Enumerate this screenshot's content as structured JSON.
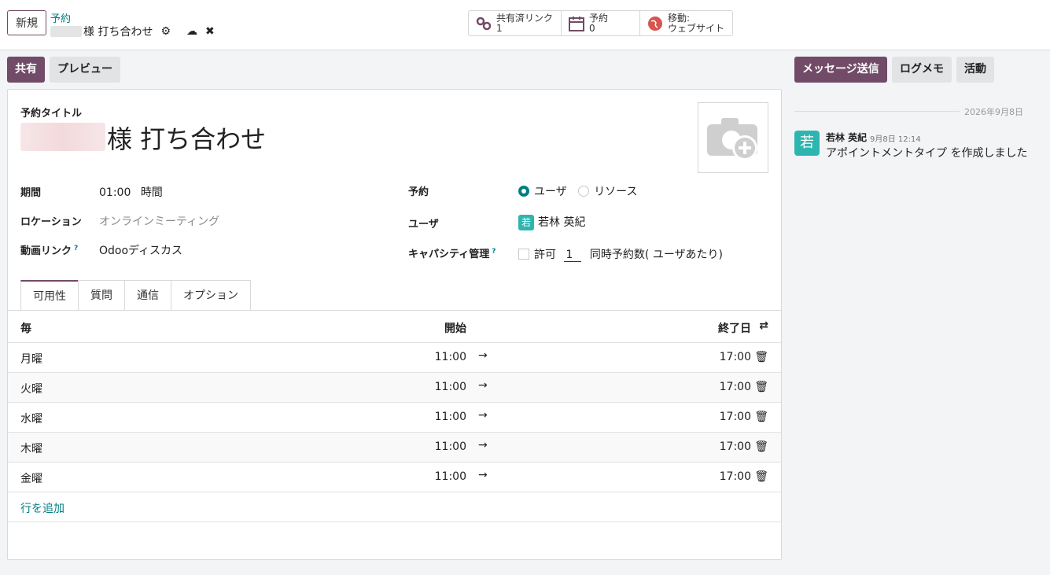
{
  "topbar": {
    "new_label": "新規",
    "breadcrumb_parent": "予約",
    "record_title": "様 打ち合わせ",
    "stats": [
      {
        "label": "共有済リンク",
        "value": "1",
        "icon": "link-icon"
      },
      {
        "label": "予約",
        "value": "0",
        "icon": "calendar-icon"
      },
      {
        "label": "移動:",
        "value": "ウェブサイト",
        "icon": "globe-icon"
      }
    ]
  },
  "controls": {
    "share_label": "共有",
    "preview_label": "プレビュー",
    "send_message_label": "メッセージ送信",
    "log_note_label": "ログメモ",
    "activity_label": "活動"
  },
  "form": {
    "title_label": "予約タイトル",
    "title_value": "様 打ち合わせ",
    "duration_label": "期間",
    "duration_value": "01:00",
    "duration_unit": "時間",
    "location_label": "ロケーション",
    "location_placeholder": "オンラインミーティング",
    "video_label": "動画リンク",
    "video_value": "Odooディスカス",
    "booking_label": "予約",
    "booking_option_user": "ユーザ",
    "booking_option_resource": "リソース",
    "users_label": "ユーザ",
    "user_name": "若林 英紀",
    "user_avatar": "若",
    "capacity_label": "キャパシティ管理",
    "capacity_allow": "許可",
    "capacity_value": "1",
    "capacity_suffix": "同時予約数( ユーザあたり)",
    "help_mark": "?"
  },
  "tabs": [
    "可用性",
    "質問",
    "通信",
    "オプション"
  ],
  "table": {
    "headers": {
      "day": "毎",
      "start": "開始",
      "end": "終了日"
    },
    "rows": [
      {
        "day": "月曜",
        "start": "11:00",
        "end": "17:00"
      },
      {
        "day": "火曜",
        "start": "11:00",
        "end": "17:00"
      },
      {
        "day": "水曜",
        "start": "11:00",
        "end": "17:00"
      },
      {
        "day": "木曜",
        "start": "11:00",
        "end": "17:00"
      },
      {
        "day": "金曜",
        "start": "11:00",
        "end": "17:00"
      }
    ],
    "add_line": "行を追加"
  },
  "chatter": {
    "date": "2026年9月8日",
    "author": "若林 英紀",
    "avatar": "若",
    "time": "9月8日 12:14",
    "message": "アポイントメントタイプ を作成しました"
  },
  "colors": {
    "brand": "#714b67",
    "accent": "#017e84",
    "avatar": "#2eb5b0"
  }
}
